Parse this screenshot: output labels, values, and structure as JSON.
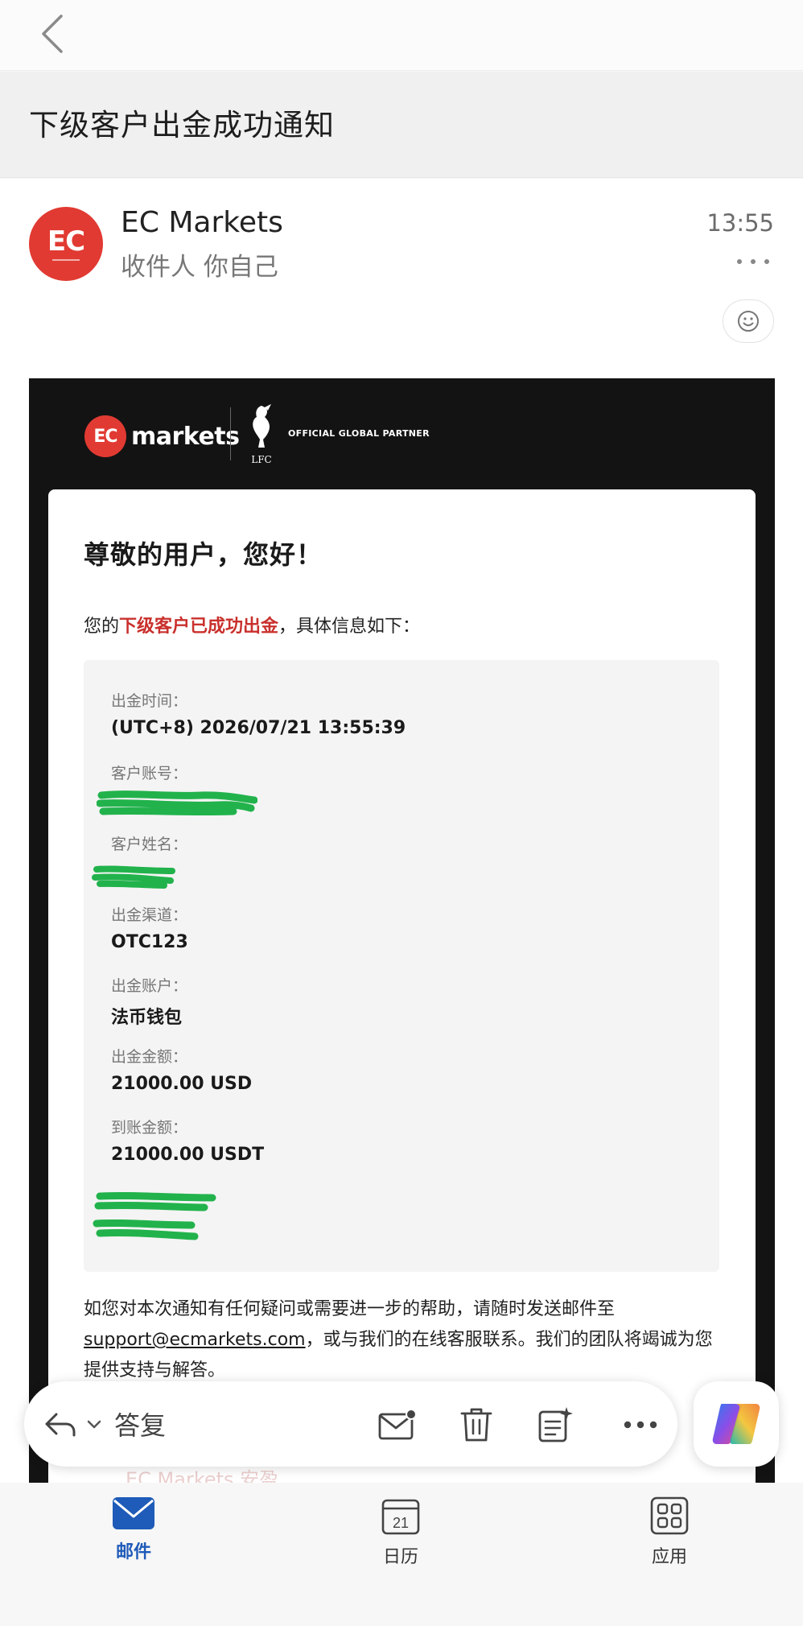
{
  "subject": "下级客户出金成功通知",
  "sender": {
    "avatar_text": "EC",
    "name": "EC Markets",
    "recipient": "收件人 你自己",
    "time": "13:55"
  },
  "email": {
    "brand": {
      "ec": "EC",
      "markets": "markets",
      "lfc": "LFC",
      "partner": "OFFICIAL GLOBAL PARTNER"
    },
    "greeting": "尊敬的用户，您好！",
    "intro_prefix": "您的",
    "intro_highlight": "下级客户已成功出金",
    "intro_suffix": "，具体信息如下：",
    "fields": {
      "time_label": "出金时间：",
      "time_value": "(UTC+8) 2026/07/21 13:55:39",
      "account_label": "客户账号：",
      "name_label": "客户姓名：",
      "channel_label": "出金渠道：",
      "channel_value": "OTC123",
      "wallet_label": "出金账户：",
      "wallet_value": "法币钱包",
      "amount_label": "出金金额：",
      "amount_value": "21000.00 USD",
      "received_label": "到账金额：",
      "received_value": "21000.00 USDT"
    },
    "footer_1": "如您对本次通知有任何疑问或需要进一步的帮助，请随时发送邮件至",
    "footer_email": "support@ecmarkets.com",
    "footer_2": "，或与我们的在线客服联系。我们的团队将竭诚为您提供支持与解答。",
    "faded_sign": "EC Markets 安盈"
  },
  "actions": {
    "reply_label": "答复"
  },
  "tabs": {
    "mail": "邮件",
    "calendar": "日历",
    "calendar_day": "21",
    "apps": "应用"
  },
  "colors": {
    "brand_red": "#e13a32",
    "highlight_red": "#c9302c",
    "active_tab": "#1f5bb8",
    "redaction_green": "#22b24c"
  }
}
